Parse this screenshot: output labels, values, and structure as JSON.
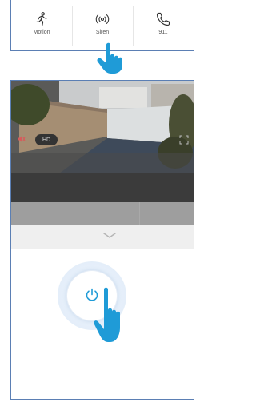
{
  "actions": [
    {
      "label": "Motion",
      "icon": "motion-running-icon"
    },
    {
      "label": "Siren",
      "icon": "siren-icon"
    },
    {
      "label": "911",
      "icon": "phone-icon"
    }
  ],
  "video": {
    "quality_badge": "HD"
  },
  "colors": {
    "frame_border": "#5b7fb4",
    "accent_blue": "#1f9bd7",
    "siren_red": "#d65b5b"
  }
}
